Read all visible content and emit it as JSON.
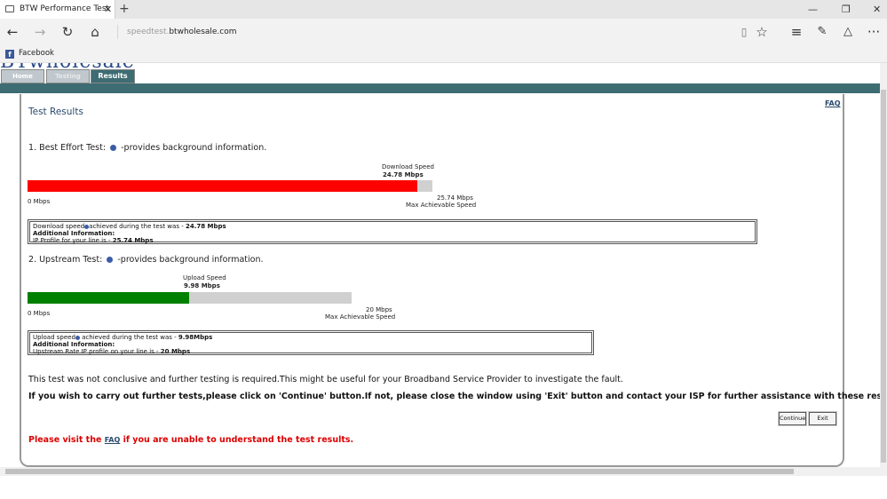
{
  "browser": {
    "tab_title": "BTW Performance Test",
    "tab_close": "✕",
    "new_tab": "+",
    "address_host_prefix": "speedtest.",
    "address_host_main": "btwholesale.com",
    "favorites": [
      {
        "label": "Facebook",
        "icon": "facebook-icon"
      }
    ],
    "window_controls": {
      "minimize": "—",
      "restore": "❐",
      "close": "✕"
    }
  },
  "site": {
    "logo_text": "BTwholesale",
    "nav": {
      "home": "Home",
      "testing": "Testing",
      "results": "Results"
    },
    "faq_top": "FAQ",
    "panel_title": "Test Results"
  },
  "best_effort": {
    "title": "1. Best Effort Test:",
    "info_text": "-provides background information.",
    "bar_label": "Download Speed",
    "speed": "24.78 Mbps",
    "fraction": 0.9627,
    "min_label": "0 Mbps",
    "max_value": "25.74 Mbps",
    "max_label": "Max Achievable Speed",
    "fill_color": "#ff0000",
    "box_line1_prefix": "Download speed",
    "box_line1_mid": "achieved during the test was - ",
    "box_line1_value": "24.78 Mbps",
    "box_line2": "Additional Information:",
    "box_line3_prefix": "IP Profile for your line is - ",
    "box_line3_value": "25.74 Mbps"
  },
  "upstream": {
    "title": "2. Upstream Test:",
    "info_text": "-provides background information.",
    "bar_label": "Upload Speed",
    "speed": "9.98 Mbps",
    "fraction": 0.499,
    "min_label": "0 Mbps",
    "max_value": "20 Mbps",
    "max_label": "Max Achievable Speed",
    "fill_color": "#008000",
    "box_line1_prefix": "Upload speed",
    "box_line1_mid": " achieved during the test was - ",
    "box_line1_value": "9.98Mbps",
    "box_line2": "Additional Information:",
    "box_line3_prefix": "Upstream Rate IP profile on your line is - ",
    "box_line3_value": "20 Mbps"
  },
  "messages": {
    "inconclusive": "This test was not conclusive and further testing is required.This might be useful for your Broadband Service Provider to investigate the fault.",
    "instruction": "If you wish to carry out further tests,please click on 'Continue' button.If not, please close the window using 'Exit' button and contact your ISP for further assistance with these results.",
    "red_prefix": "Please visit the ",
    "red_link": "FAQ",
    "red_suffix": " if you are unable to understand the test results."
  },
  "buttons": {
    "continue": "Continue",
    "exit": "Exit"
  }
}
